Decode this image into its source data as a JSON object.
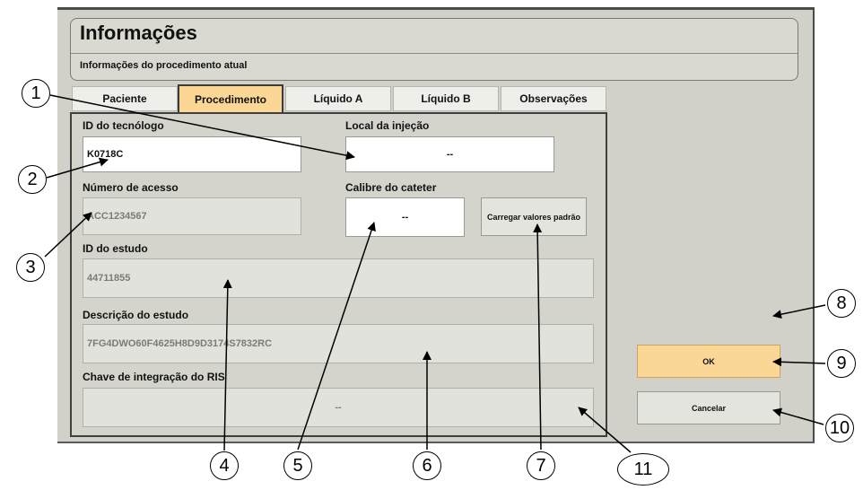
{
  "dialog": {
    "title": "Informações",
    "subtitle": "Informações do procedimento atual"
  },
  "tabs": [
    {
      "label": "Paciente",
      "active": false
    },
    {
      "label": "Procedimento",
      "active": true
    },
    {
      "label": "Líquido A",
      "active": false
    },
    {
      "label": "Líquido B",
      "active": false
    },
    {
      "label": "Observações",
      "active": false
    }
  ],
  "form": {
    "technologist_id": {
      "label": "ID do tecnólogo",
      "value": "K0718C"
    },
    "injection_site": {
      "label": "Local da injeção",
      "value": "--"
    },
    "accession_number": {
      "label": "Número de acesso",
      "value": "ACC1234567"
    },
    "catheter_gauge": {
      "label": "Calibre do cateter",
      "value": "--"
    },
    "load_defaults_button": "Carregar valores padrão",
    "study_id": {
      "label": "ID do estudo",
      "value": "44711855"
    },
    "study_description": {
      "label": "Descrição do estudo",
      "value": "7FG4DWO60F4625H8D9D3174S7832RC"
    },
    "ris_key": {
      "label": "Chave de integração do RIS",
      "value": "--"
    }
  },
  "actions": {
    "ok": "OK",
    "cancel": "Cancelar"
  },
  "callouts": [
    "1",
    "2",
    "3",
    "4",
    "5",
    "6",
    "7",
    "8",
    "9",
    "10",
    "11"
  ],
  "colors": {
    "active_tab": "#fbd695",
    "dialog_bg": "#d1d1c9",
    "readonly_field": "#e2e2dc"
  }
}
